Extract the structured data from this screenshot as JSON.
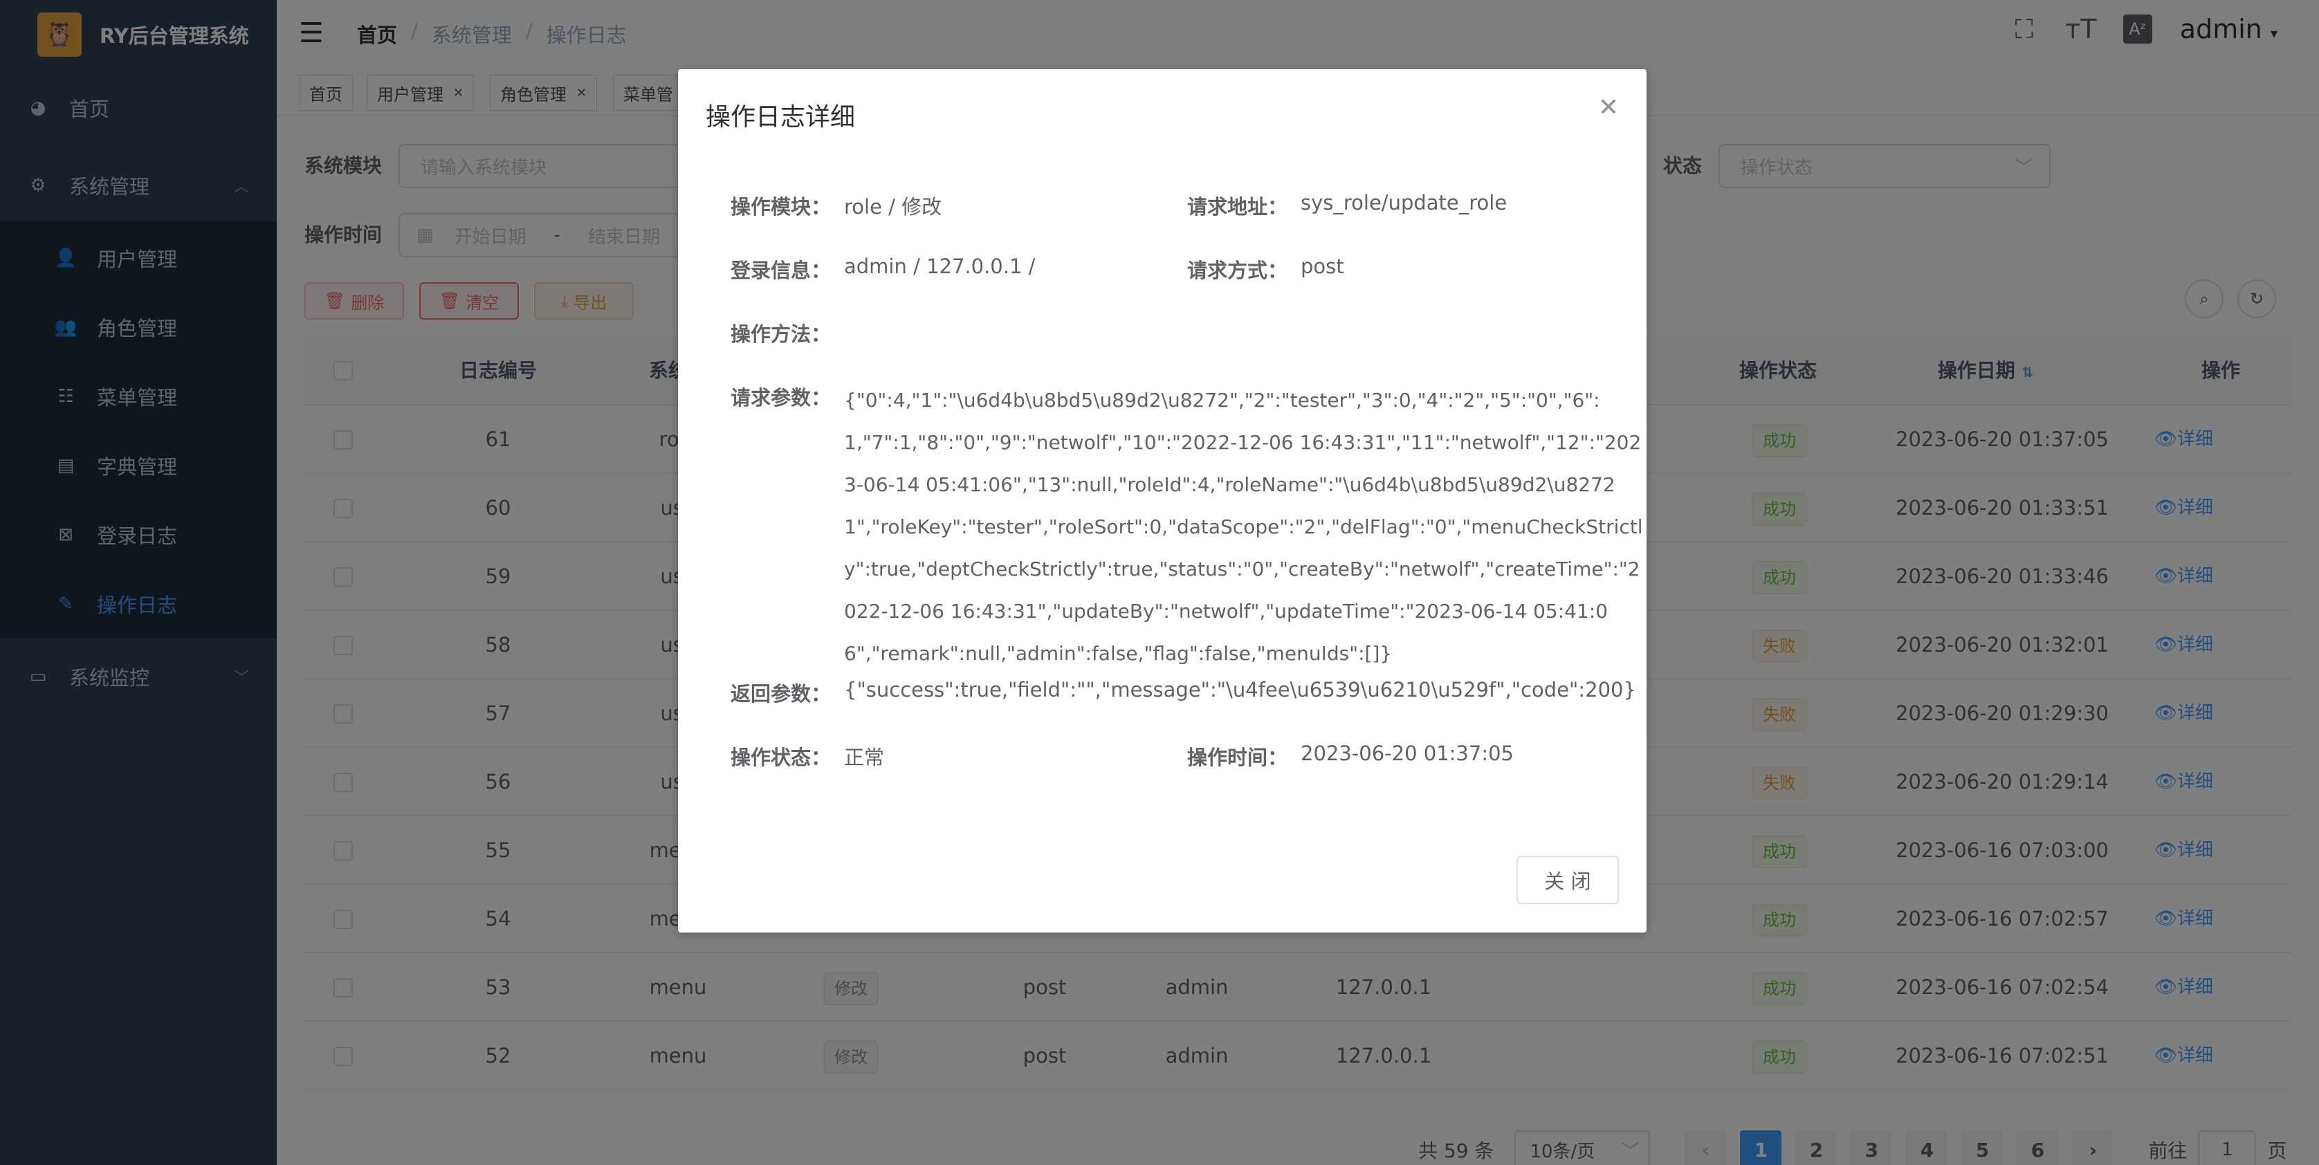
{
  "app": {
    "title": "RY后台管理系统",
    "logo_glyph": "🦉"
  },
  "sidebar": {
    "items": [
      {
        "label": "首页",
        "icon": "dashboard-icon"
      },
      {
        "label": "系统管理",
        "icon": "gear-icon",
        "expanded": true
      },
      {
        "label": "用户管理",
        "icon": "user-icon"
      },
      {
        "label": "角色管理",
        "icon": "peoples-icon"
      },
      {
        "label": "菜单管理",
        "icon": "tree-table-icon"
      },
      {
        "label": "字典管理",
        "icon": "dict-icon"
      },
      {
        "label": "登录日志",
        "icon": "logininfor-icon"
      },
      {
        "label": "操作日志",
        "icon": "form-icon",
        "active": true
      },
      {
        "label": "系统监控",
        "icon": "monitor-icon"
      }
    ]
  },
  "navbar": {
    "breadcrumb": [
      "首页",
      "系统管理",
      "操作日志"
    ],
    "user": "admin"
  },
  "tags": [
    {
      "label": "首页",
      "closable": false
    },
    {
      "label": "用户管理",
      "closable": true
    },
    {
      "label": "角色管理",
      "closable": true
    },
    {
      "label": "菜单管",
      "closable": false
    }
  ],
  "search": {
    "module_label": "系统模块",
    "module_placeholder": "请输入系统模块",
    "status_label": "状态",
    "status_placeholder": "操作状态",
    "time_label": "操作时间",
    "start_placeholder": "开始日期",
    "range_sep": "-",
    "end_placeholder": "结束日期"
  },
  "toolbar": {
    "delete_label": "删除",
    "clear_label": "清空",
    "export_label": "导出"
  },
  "table": {
    "headers": {
      "id": "日志编号",
      "module": "系统模",
      "status": "操作状态",
      "date": "操作日期",
      "action": "操作"
    },
    "rows": [
      {
        "id": "61",
        "module": "role",
        "type": "",
        "method": "",
        "user": "",
        "ip": "",
        "status": "成功",
        "status_kind": "ok",
        "date": "2023-06-20 01:37:05",
        "action": "详细"
      },
      {
        "id": "60",
        "module": "use",
        "type": "",
        "method": "",
        "user": "",
        "ip": "",
        "status": "成功",
        "status_kind": "ok",
        "date": "2023-06-20 01:33:51",
        "action": "详细"
      },
      {
        "id": "59",
        "module": "use",
        "type": "",
        "method": "",
        "user": "",
        "ip": "",
        "status": "成功",
        "status_kind": "ok",
        "date": "2023-06-20 01:33:46",
        "action": "详细"
      },
      {
        "id": "58",
        "module": "use",
        "type": "",
        "method": "",
        "user": "",
        "ip": "",
        "status": "失败",
        "status_kind": "fail",
        "date": "2023-06-20 01:32:01",
        "action": "详细"
      },
      {
        "id": "57",
        "module": "use",
        "type": "",
        "method": "",
        "user": "",
        "ip": "",
        "status": "失败",
        "status_kind": "fail",
        "date": "2023-06-20 01:29:30",
        "action": "详细"
      },
      {
        "id": "56",
        "module": "use",
        "type": "",
        "method": "",
        "user": "",
        "ip": "",
        "status": "失败",
        "status_kind": "fail",
        "date": "2023-06-20 01:29:14",
        "action": "详细"
      },
      {
        "id": "55",
        "module": "menu",
        "type": "",
        "method": "",
        "user": "",
        "ip": "",
        "status": "成功",
        "status_kind": "ok",
        "date": "2023-06-16 07:03:00",
        "action": "详细"
      },
      {
        "id": "54",
        "module": "menu",
        "type": "",
        "method": "",
        "user": "",
        "ip": "",
        "status": "成功",
        "status_kind": "ok",
        "date": "2023-06-16 07:02:57",
        "action": "详细"
      },
      {
        "id": "53",
        "module": "menu",
        "type": "修改",
        "method": "post",
        "user": "admin",
        "ip": "127.0.0.1",
        "status": "成功",
        "status_kind": "ok",
        "date": "2023-06-16 07:02:54",
        "action": "详细"
      },
      {
        "id": "52",
        "module": "menu",
        "type": "修改",
        "method": "post",
        "user": "admin",
        "ip": "127.0.0.1",
        "status": "成功",
        "status_kind": "ok",
        "date": "2023-06-16 07:02:51",
        "action": "详细"
      }
    ]
  },
  "pagination": {
    "total": "共 59 条",
    "size": "10条/页",
    "pages": [
      "1",
      "2",
      "3",
      "4",
      "5",
      "6"
    ],
    "current": "1",
    "goto_label": "前往",
    "goto_value": "1",
    "page_suffix": "页"
  },
  "dialog": {
    "title": "操作日志详细",
    "fields": {
      "module_label": "操作模块：",
      "module_value": "role / 修改",
      "url_label": "请求地址：",
      "url_value": "sys_role/update_role",
      "login_label": "登录信息：",
      "login_value": "admin / 127.0.0.1 /",
      "method_label": "请求方式：",
      "method_value": "post",
      "op_method_label": "操作方法：",
      "op_method_value": "",
      "param_label": "请求参数：",
      "param_value": "{\"0\":4,\"1\":\"\\u6d4b\\u8bd5\\u89d2\\u8272\",\"2\":\"tester\",\"3\":0,\"4\":\"2\",\"5\":\"0\",\"6\":1,\"7\":1,\"8\":\"0\",\"9\":\"netwolf\",\"10\":\"2022-12-06 16:43:31\",\"11\":\"netwolf\",\"12\":\"2023-06-14 05:41:06\",\"13\":null,\"roleId\":4,\"roleName\":\"\\u6d4b\\u8bd5\\u89d2\\u82721\",\"roleKey\":\"tester\",\"roleSort\":0,\"dataScope\":\"2\",\"delFlag\":\"0\",\"menuCheckStrictly\":true,\"deptCheckStrictly\":true,\"status\":\"0\",\"createBy\":\"netwolf\",\"createTime\":\"2022-12-06 16:43:31\",\"updateBy\":\"netwolf\",\"updateTime\":\"2023-06-14 05:41:06\",\"remark\":null,\"admin\":false,\"flag\":false,\"menuIds\":[]}",
      "result_label": "返回参数：",
      "result_value": "{\"success\":true,\"field\":\"\",\"message\":\"\\u4fee\\u6539\\u6210\\u529f\",\"code\":200}",
      "status_label": "操作状态：",
      "status_value": "正常",
      "time_label": "操作时间：",
      "time_value": "2023-06-20 01:37:05"
    },
    "close_button": "关 闭"
  },
  "colors": {
    "sidebar_bg": "#304156",
    "submenu_bg": "#1f2d3d",
    "primary": "#409eff",
    "success": "#67c23a",
    "warning": "#e6a23c",
    "danger": "#f56c6c"
  }
}
